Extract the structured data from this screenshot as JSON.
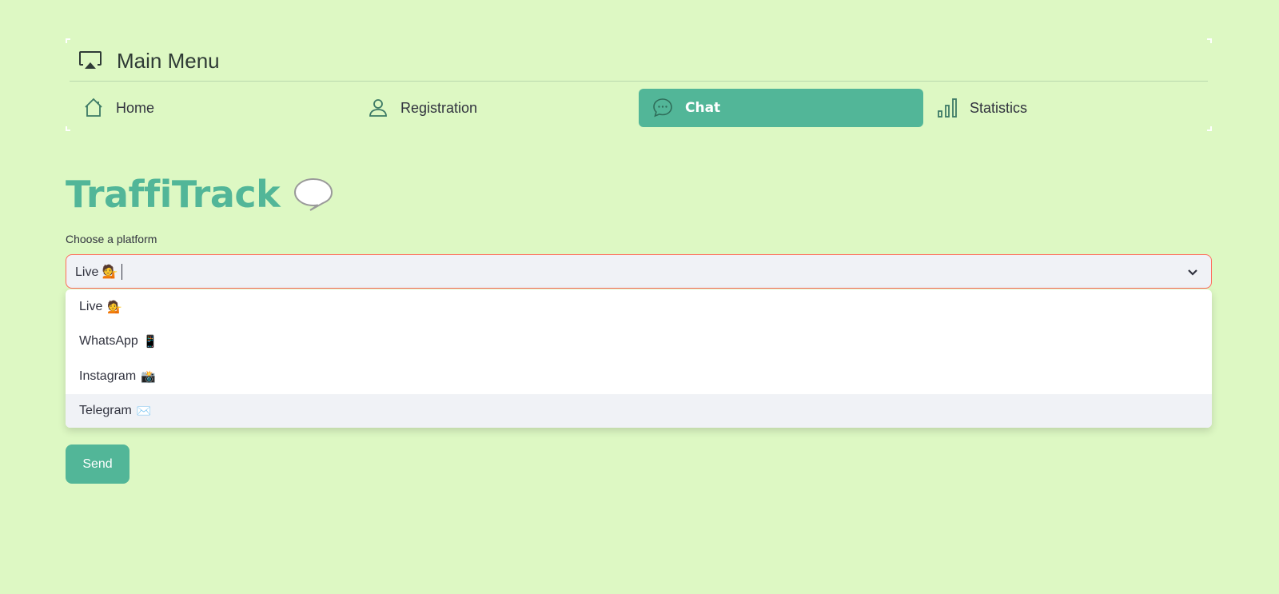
{
  "menu": {
    "title": "Main Menu",
    "items": [
      {
        "label": "Home",
        "icon": "house-icon",
        "active": false
      },
      {
        "label": "Registration",
        "icon": "person-icon",
        "active": false
      },
      {
        "label": "Chat",
        "icon": "chat-dots-icon",
        "active": true
      },
      {
        "label": "Statistics",
        "icon": "bar-chart-icon",
        "active": false
      }
    ]
  },
  "page": {
    "title": "TraffiTrack",
    "title_icon": "speech-balloon-icon"
  },
  "platform_select": {
    "label": "Choose a platform",
    "value": "Live 💁",
    "options": [
      {
        "label": "Live",
        "emoji": "💁"
      },
      {
        "label": "WhatsApp",
        "emoji": "📱"
      },
      {
        "label": "Instagram",
        "emoji": "📸"
      },
      {
        "label": "Telegram",
        "emoji": "✉️"
      }
    ],
    "highlighted_index": 3
  },
  "send_button": "Send",
  "colors": {
    "background": "#ddf8c3",
    "accent": "#52b698",
    "input_bg": "#f0f2f6",
    "focus_border": "#ff6b5b"
  }
}
